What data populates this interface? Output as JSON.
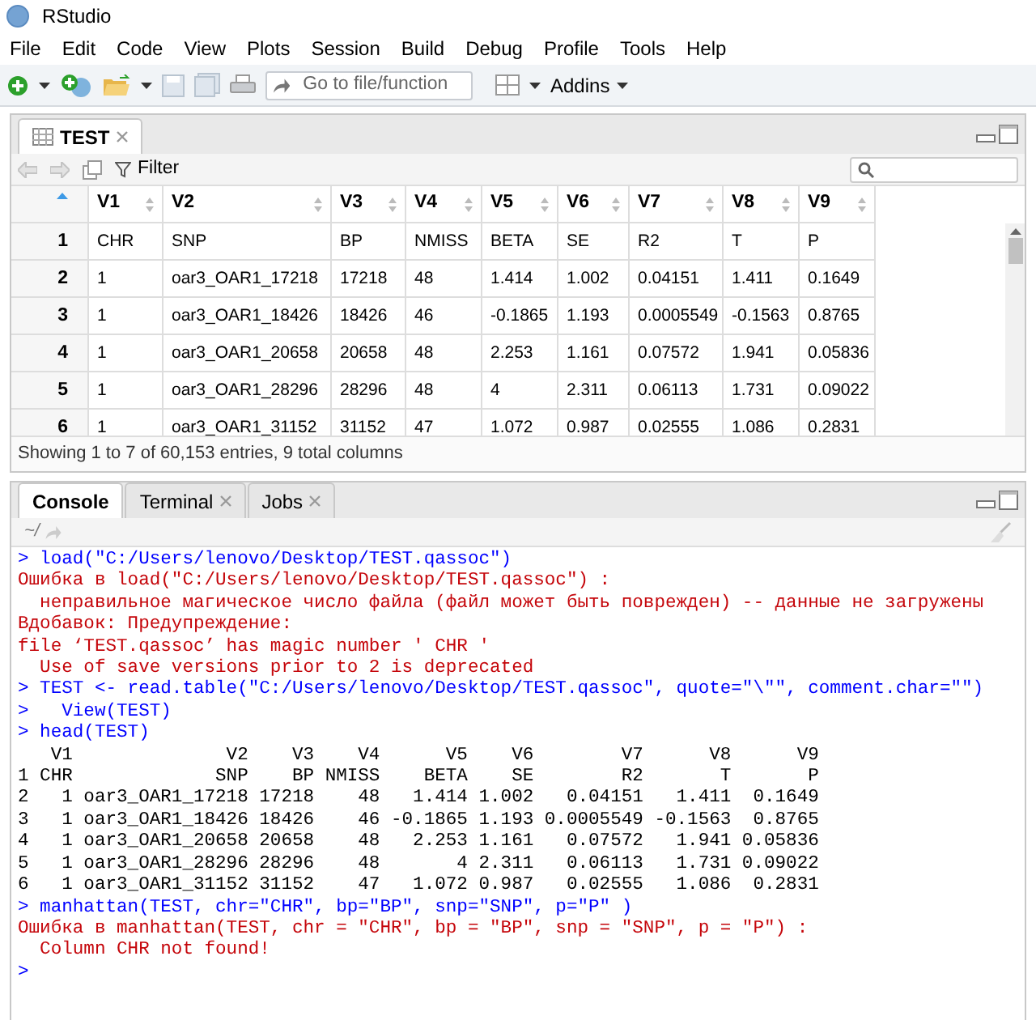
{
  "window": {
    "title": "RStudio"
  },
  "menu": [
    "File",
    "Edit",
    "Code",
    "View",
    "Plots",
    "Session",
    "Build",
    "Debug",
    "Profile",
    "Tools",
    "Help"
  ],
  "toolbar": {
    "goto": {
      "placeholder": "Go to file/function"
    },
    "addins": "Addins"
  },
  "viewer": {
    "tabs": [
      {
        "label": "TEST",
        "selected": true
      }
    ],
    "filter": "Filter",
    "columns": [
      "V1",
      "V2",
      "V3",
      "V4",
      "V5",
      "V6",
      "V7",
      "V8",
      "V9"
    ],
    "rows": [
      {
        "index": "1",
        "cells": [
          "CHR",
          "SNP",
          "BP",
          "NMISS",
          "BETA",
          "SE",
          "R2",
          "T",
          "P"
        ]
      },
      {
        "index": "2",
        "cells": [
          "1",
          "oar3_OAR1_17218",
          "17218",
          "48",
          "1.414",
          "1.002",
          "0.04151",
          "1.411",
          "0.1649"
        ]
      },
      {
        "index": "3",
        "cells": [
          "1",
          "oar3_OAR1_18426",
          "18426",
          "46",
          "-0.1865",
          "1.193",
          "0.0005549",
          "-0.1563",
          "0.8765"
        ]
      },
      {
        "index": "4",
        "cells": [
          "1",
          "oar3_OAR1_20658",
          "20658",
          "48",
          "2.253",
          "1.161",
          "0.07572",
          "1.941",
          "0.05836"
        ]
      },
      {
        "index": "5",
        "cells": [
          "1",
          "oar3_OAR1_28296",
          "28296",
          "48",
          "4",
          "2.311",
          "0.06113",
          "1.731",
          "0.09022"
        ]
      },
      {
        "index": "6",
        "cells": [
          "1",
          "oar3_OAR1_31152",
          "31152",
          "47",
          "1.072",
          "0.987",
          "0.02555",
          "1.086",
          "0.2831"
        ]
      }
    ],
    "status": "Showing 1 to 7 of 60,153 entries, 9 total columns"
  },
  "console": {
    "tabs": [
      {
        "label": "Console",
        "selected": true,
        "closable": false
      },
      {
        "label": "Terminal",
        "selected": false,
        "closable": true
      },
      {
        "label": "Jobs",
        "selected": false,
        "closable": true
      }
    ],
    "path": "~/",
    "lines": [
      {
        "kind": "input",
        "text": "> load(\"C:/Users/lenovo/Desktop/TEST.qassoc\")"
      },
      {
        "kind": "error",
        "text": "Ошибка в load(\"C:/Users/lenovo/Desktop/TEST.qassoc\") :"
      },
      {
        "kind": "error",
        "text": "  неправильное магическое число файла (файл может быть поврежден) -- данные не загружены"
      },
      {
        "kind": "error",
        "text": "Вдобавок: Предупреждение:"
      },
      {
        "kind": "error",
        "text": "file ‘TEST.qassoc’ has magic number ' CHR '"
      },
      {
        "kind": "error",
        "text": "  Use of save versions prior to 2 is deprecated"
      },
      {
        "kind": "input",
        "text": "> TEST <- read.table(\"C:/Users/lenovo/Desktop/TEST.qassoc\", quote=\"\\\"\", comment.char=\"\")"
      },
      {
        "kind": "input",
        "text": ">   View(TEST)"
      },
      {
        "kind": "input",
        "text": "> head(TEST)"
      },
      {
        "kind": "output",
        "text": "   V1              V2    V3    V4      V5    V6        V7      V8      V9"
      },
      {
        "kind": "output",
        "text": "1 CHR             SNP    BP NMISS    BETA    SE        R2       T       P"
      },
      {
        "kind": "output",
        "text": "2   1 oar3_OAR1_17218 17218    48   1.414 1.002   0.04151   1.411  0.1649"
      },
      {
        "kind": "output",
        "text": "3   1 oar3_OAR1_18426 18426    46 -0.1865 1.193 0.0005549 -0.1563  0.8765"
      },
      {
        "kind": "output",
        "text": "4   1 oar3_OAR1_20658 20658    48   2.253 1.161   0.07572   1.941 0.05836"
      },
      {
        "kind": "output",
        "text": "5   1 oar3_OAR1_28296 28296    48       4 2.311   0.06113   1.731 0.09022"
      },
      {
        "kind": "output",
        "text": "6   1 oar3_OAR1_31152 31152    47   1.072 0.987   0.02555   1.086  0.2831"
      },
      {
        "kind": "input",
        "text": "> manhattan(TEST, chr=\"CHR\", bp=\"BP\", snp=\"SNP\", p=\"P\" )"
      },
      {
        "kind": "error",
        "text": "Ошибка в manhattan(TEST, chr = \"CHR\", bp = \"BP\", snp = \"SNP\", p = \"P\") :"
      },
      {
        "kind": "error",
        "text": "  Column CHR not found!"
      },
      {
        "kind": "input",
        "text": ">"
      }
    ]
  }
}
